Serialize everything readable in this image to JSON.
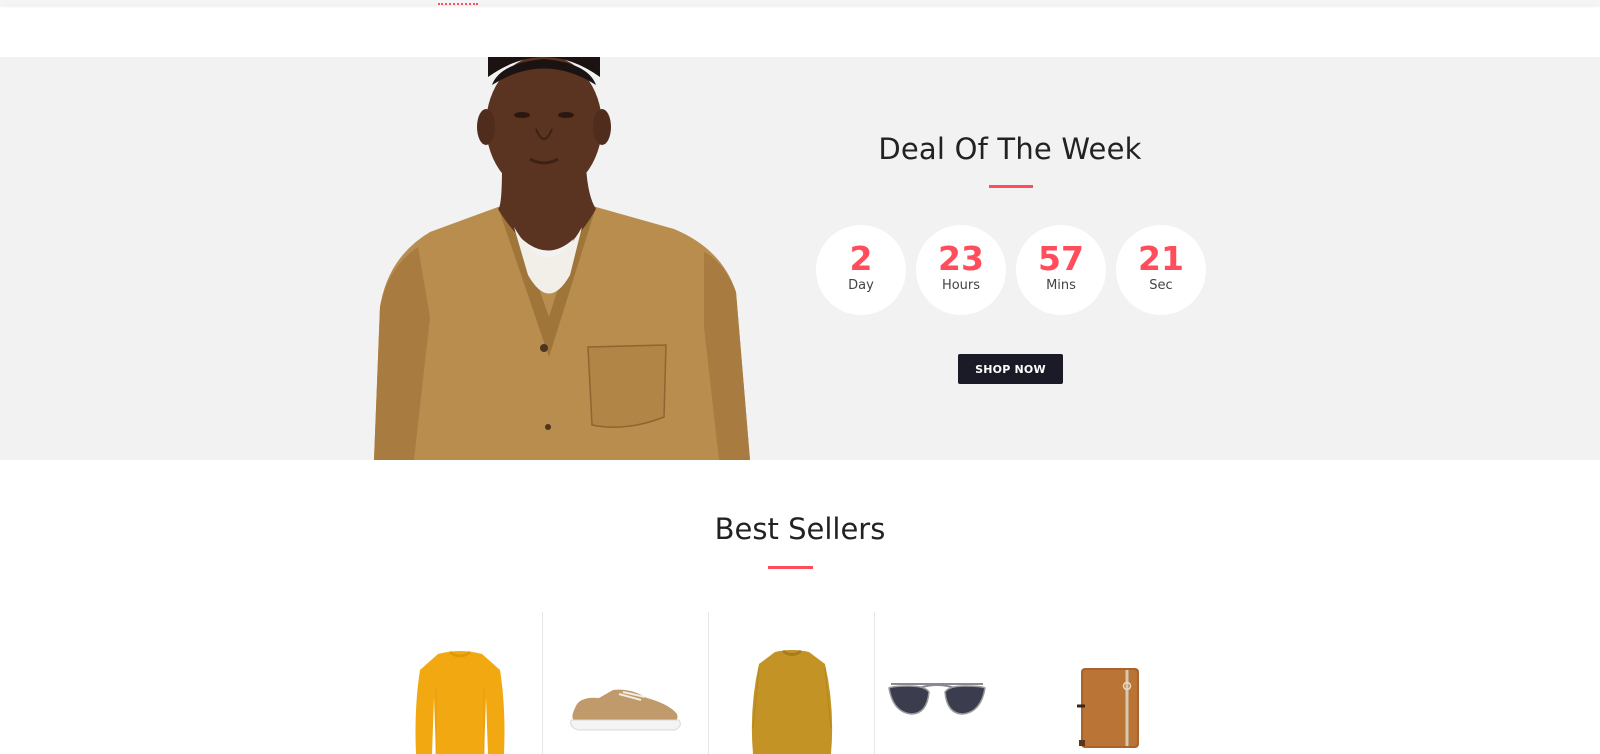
{
  "deal": {
    "title": "Deal Of The Week",
    "countdown": [
      {
        "value": "2",
        "label": "Day"
      },
      {
        "value": "23",
        "label": "Hours"
      },
      {
        "value": "57",
        "label": "Mins"
      },
      {
        "value": "21",
        "label": "Sec"
      }
    ],
    "button_label": "SHOP NOW"
  },
  "best_sellers": {
    "title": "Best Sellers",
    "products": [
      {
        "icon": "yellow-sweater-icon"
      },
      {
        "icon": "sneaker-icon"
      },
      {
        "icon": "mustard-dress-icon"
      },
      {
        "icon": "aviator-sunglasses-icon"
      },
      {
        "icon": "leather-wallet-icon"
      }
    ]
  },
  "colors": {
    "accent": "#ff4d5c",
    "deal_background": "#f2f2f2",
    "button_background": "#1b1b27"
  }
}
